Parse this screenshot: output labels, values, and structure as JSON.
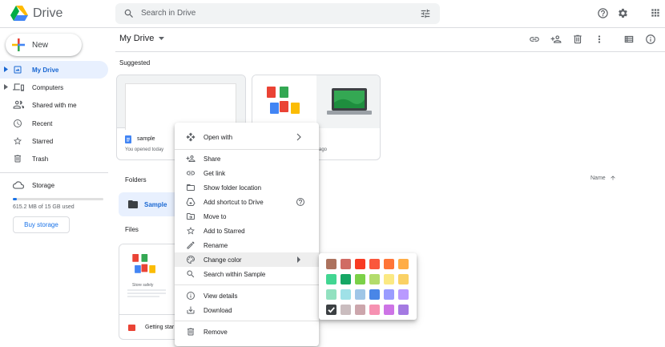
{
  "header": {
    "app_name": "Drive",
    "search_placeholder": "Search in Drive"
  },
  "sidebar": {
    "new_label": "New",
    "items": [
      {
        "label": "My Drive",
        "icon": "my-drive-icon",
        "active": true
      },
      {
        "label": "Computers",
        "icon": "computer-icon"
      },
      {
        "label": "Shared with me",
        "icon": "people-icon"
      },
      {
        "label": "Recent",
        "icon": "clock-icon"
      },
      {
        "label": "Starred",
        "icon": "star-icon"
      },
      {
        "label": "Trash",
        "icon": "trash-icon"
      }
    ],
    "storage_label": "Storage",
    "storage_text": "615.2 MB of 15 GB used",
    "storage_fraction": 0.041,
    "buy_label": "Buy storage"
  },
  "main": {
    "title": "My Drive",
    "suggested_label": "Suggested",
    "suggested": [
      {
        "name": "sample",
        "sub": "You opened today",
        "icon": "docs-icon"
      },
      {
        "name": "",
        "sub": "ago",
        "icon": "files-icon"
      }
    ],
    "folders_label": "Folders",
    "folders": [
      {
        "name": "Sample"
      }
    ],
    "sort_label": "Name",
    "files_label": "Files",
    "files": [
      {
        "name": "Getting star",
        "thumb_text": "Store safely"
      }
    ]
  },
  "context_menu": {
    "items": [
      {
        "label": "Open with",
        "icon": "open-with-icon",
        "submenu": true
      },
      {
        "label": "Share",
        "icon": "person-add-icon"
      },
      {
        "label": "Get link",
        "icon": "link-icon"
      },
      {
        "label": "Show folder location",
        "icon": "folder-icon"
      },
      {
        "label": "Add shortcut to Drive",
        "icon": "add-shortcut-icon",
        "help": true
      },
      {
        "label": "Move to",
        "icon": "move-to-icon"
      },
      {
        "label": "Add to Starred",
        "icon": "star-icon"
      },
      {
        "label": "Rename",
        "icon": "pencil-icon"
      },
      {
        "label": "Change color",
        "icon": "palette-icon",
        "submenu": true,
        "highlighted": true
      },
      {
        "label": "Search within Sample",
        "icon": "search-icon"
      },
      {
        "label": "View details",
        "icon": "info-icon"
      },
      {
        "label": "Download",
        "icon": "download-icon"
      },
      {
        "label": "Remove",
        "icon": "trash-icon"
      }
    ]
  },
  "palette": {
    "colors": [
      "#ac725e",
      "#d06b64",
      "#f83a22",
      "#fa573c",
      "#ff7537",
      "#ffad46",
      "#42d692",
      "#16a765",
      "#7bd148",
      "#b3dc6c",
      "#fbe983",
      "#fad165",
      "#92e1c0",
      "#9fe1e7",
      "#9fc6e7",
      "#4986e7",
      "#9a9cff",
      "#b99aff",
      "#8f8f8f",
      "#cabdbf",
      "#cca6ac",
      "#f691b2",
      "#cd74e6",
      "#a47ae2"
    ],
    "selected_index": 18
  },
  "colors": {
    "accent": "#1a73e8",
    "active_bg": "#e8f0fe",
    "active_text": "#1967d2"
  }
}
